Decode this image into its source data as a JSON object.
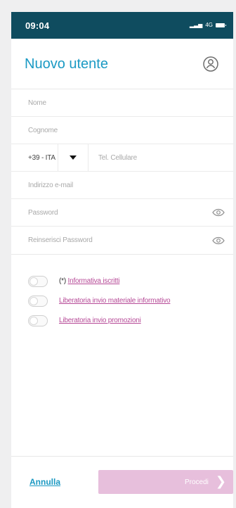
{
  "status_bar": {
    "time": "09:04",
    "network": "4G"
  },
  "header": {
    "title": "Nuovo utente",
    "user_icon": "user-icon"
  },
  "form": {
    "name_placeholder": "Nome",
    "surname_placeholder": "Cognome",
    "prefix": "+39 - ITA",
    "phone_placeholder": "Tel. Cellulare",
    "email_placeholder": "Indirizzo e-mail",
    "password_placeholder": "Password",
    "confirm_password_placeholder": "Reinserisci Password",
    "eye_icon": "eye-icon",
    "dropdown_icon": "chevron-down-icon"
  },
  "consents": [
    {
      "prefix": "(*) ",
      "label": "Informativa iscritti"
    },
    {
      "prefix": "",
      "label": "Liberatoria invio materiale informativo"
    },
    {
      "prefix": "",
      "label": "Liberatoria invio promozioni"
    }
  ],
  "footer": {
    "cancel_label": "Annulla",
    "proceed_label": "Procedi",
    "proceed_icon": "chevron-right-icon"
  },
  "colors": {
    "status_bar": "#0f4c5f",
    "title": "#1b9ac4",
    "link": "#b64a97",
    "proceed_button": "#e7bfdc"
  }
}
